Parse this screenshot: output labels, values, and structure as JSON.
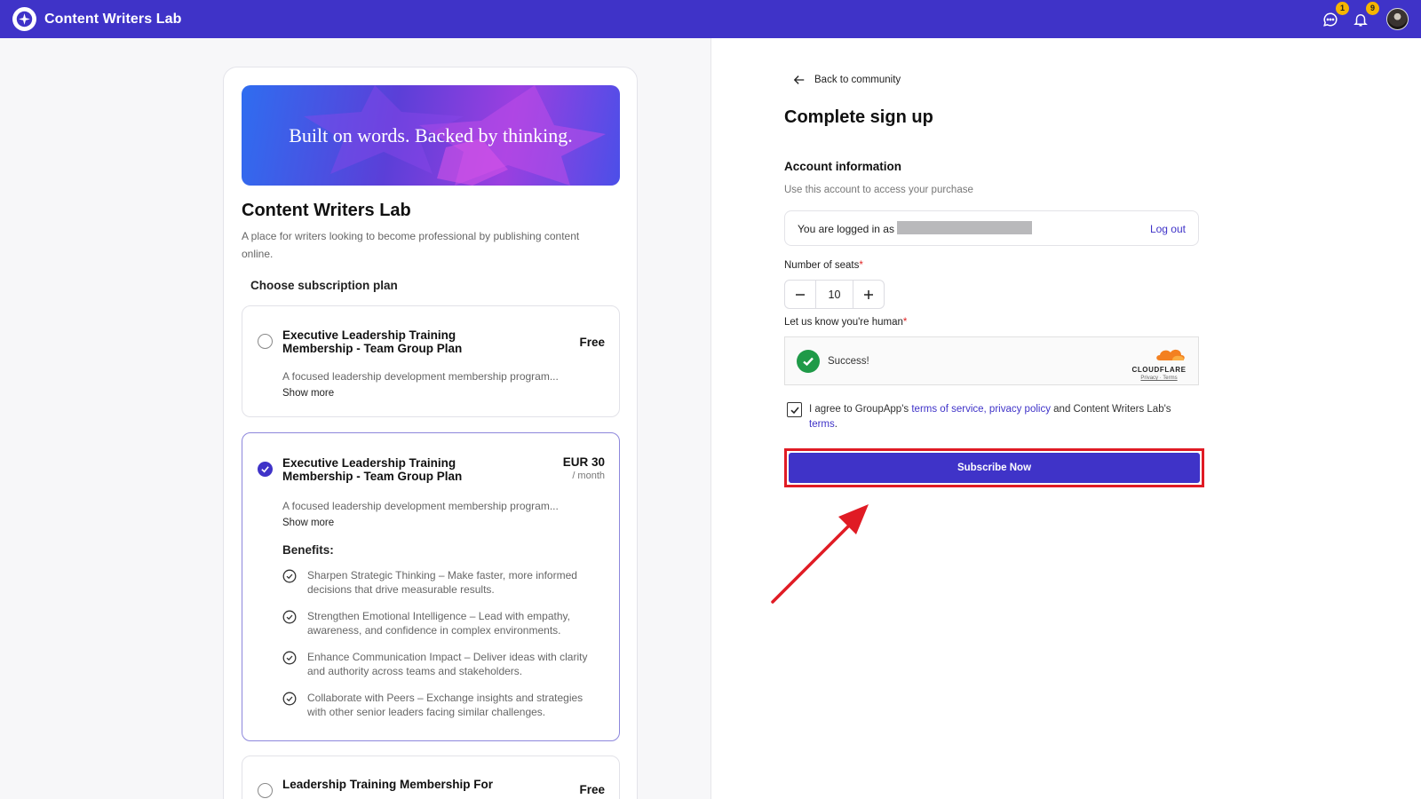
{
  "app": {
    "name": "Content Writers Lab"
  },
  "topbar": {
    "messages_badge": "1",
    "notifications_badge": "9"
  },
  "community": {
    "banner_text": "Built on words. Backed by thinking.",
    "title": "Content Writers Lab",
    "description": "A place for writers looking to become professional by publishing content online.",
    "choose_plan_label": "Choose subscription plan"
  },
  "plans": [
    {
      "name": "Executive Leadership Training Membership - Team Group Plan",
      "price": "Free",
      "description": "A focused leadership development membership program...",
      "show_more": "Show more",
      "selected": false
    },
    {
      "name": "Executive Leadership Training Membership - Team Group Plan",
      "price": "EUR 30",
      "period": "/ month",
      "description": "A focused leadership development membership program...",
      "show_more": "Show more",
      "selected": true,
      "benefits_title": "Benefits:",
      "benefits": [
        "Sharpen Strategic Thinking – Make faster, more informed decisions that drive measurable results.",
        "Strengthen Emotional Intelligence – Lead with empathy, awareness, and confidence in complex environments.",
        "Enhance Communication Impact – Deliver ideas with clarity and authority across teams and stakeholders.",
        "Collaborate with Peers – Exchange insights and strategies with other senior leaders facing similar challenges."
      ]
    },
    {
      "name": "Leadership Training Membership For",
      "price": "Free",
      "selected": false
    }
  ],
  "signup": {
    "back_label": "Back to community",
    "title": "Complete sign up",
    "account_title": "Account information",
    "account_sub": "Use this account to access your purchase",
    "logged_in_text": "You are logged in as",
    "logout_label": "Log out",
    "seats_label": "Number of seats",
    "seats_value": "10",
    "human_label": "Let us know you're human",
    "required_mark": "*",
    "captcha_status": "Success!",
    "captcha_brand": "CLOUDFLARE",
    "captcha_links": "Privacy · Terms",
    "agree_prefix": "I agree to GroupApp's ",
    "agree_terms": "terms of service",
    "agree_comma": ", ",
    "agree_privacy": "privacy policy",
    "agree_mid": " and Content Writers Lab's ",
    "agree_terms2": "terms",
    "agree_end": ".",
    "agreed": true,
    "subscribe_label": "Subscribe Now"
  },
  "colors": {
    "brand": "#3f33c8",
    "annotation": "#e01b24",
    "success": "#1f9a48",
    "badge": "#f5b400"
  }
}
